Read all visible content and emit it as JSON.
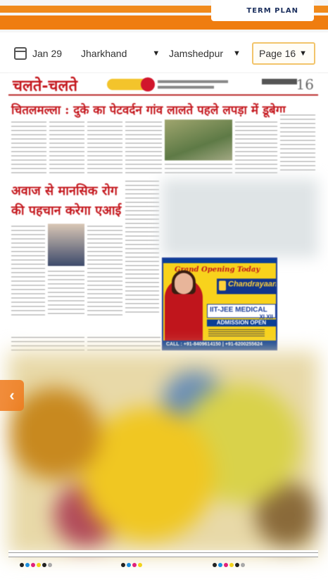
{
  "header": {
    "brand_label": "TERM PLAN"
  },
  "toolbar": {
    "date": "Jan 29",
    "state": "Jharkhand",
    "city": "Jamshedpur",
    "page": "Page 16"
  },
  "newspaper": {
    "section_title": "चलते-चलते",
    "page_number": "16",
    "headline_main": "चितलमल्ला : दुके का पेटवर्दन गांव लालते पहले लपड़ा में डूबेगा",
    "headline_second_line1": "अवाज से मानसिक रोग",
    "headline_second_line2": "की पहचान करेगा एआई"
  },
  "advertisement": {
    "heading": "Grand Opening Today",
    "brand": "Chandrayaan",
    "courses": "IIT-JEE MEDICAL",
    "classes": "XI XII",
    "banner": "ADMISSION OPEN",
    "contact": "CALL : +91-8409614150 | +91-6200255624"
  },
  "colors": {
    "accent_orange": "#ef7d10",
    "headline_red": "#c4171d",
    "ad_yellow": "#f8d21c",
    "ad_blue": "#0b3f96"
  }
}
